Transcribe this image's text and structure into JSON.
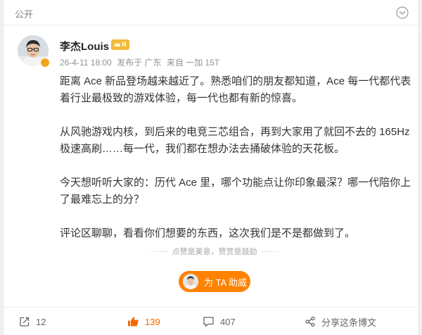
{
  "visibility": {
    "label": "公开"
  },
  "author": {
    "name": "李杰Louis",
    "member_level": "II",
    "time": "26-4-11 18:00",
    "location": "发布于 广东",
    "source": "来自 一加 15T"
  },
  "post": {
    "paragraphs": [
      "距离 Ace 新品登场越来越近了。熟悉咱们的朋友都知道，Ace 每一代都代表着行业最极致的游戏体验，每一代也都有新的惊喜。",
      "从风驰游戏内核，到后来的电竞三芯组合，再到大家用了就回不去的 165Hz 极速高刷……每一代，我们都在想办法去捅破体验的天花板。",
      "今天想听听大家的：历代 Ace 里，哪个功能点让你印象最深？哪一代陪你上了最难忘上的分？",
      "评论区聊聊，看看你们想要的东西，这次我们是不是都做到了。"
    ]
  },
  "reward": {
    "divider_text": "点赞是美意，赞赏是鼓励",
    "button_label": "为 TA 助威"
  },
  "actions": {
    "share_count": "12",
    "like_count": "139",
    "comment_count": "407",
    "share_label": "分享这条博文"
  },
  "colors": {
    "accent": "#ff8200",
    "like_active": "#f56a00",
    "badge": "#f3b93b"
  },
  "icons": {
    "more": "chevron-down-icon",
    "share": "share-icon",
    "like": "thumbs-up-icon",
    "comment": "comment-icon",
    "forward": "forward-share-icon"
  }
}
